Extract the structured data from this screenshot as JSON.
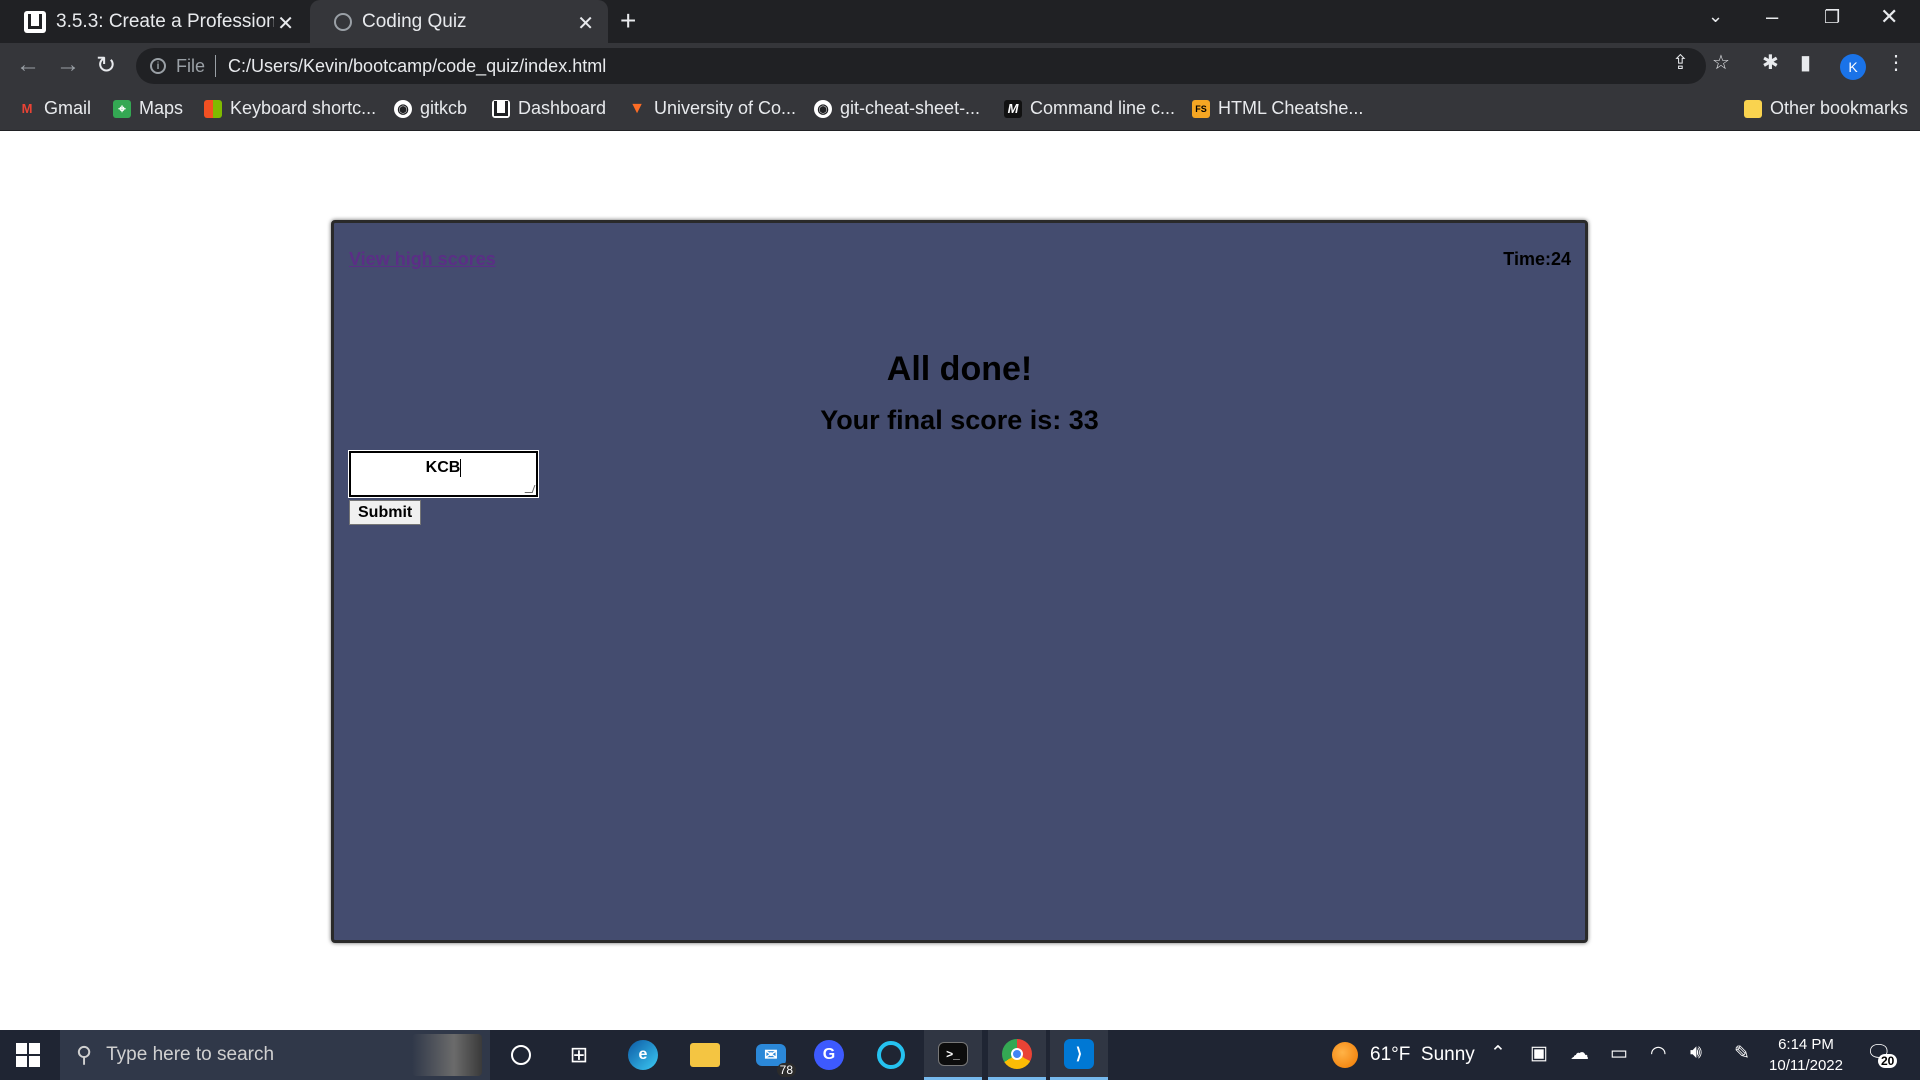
{
  "browser": {
    "tabs": [
      {
        "title": "3.5.3: Create a Professional P",
        "icon": "u-icon",
        "active": false
      },
      {
        "title": "Coding Quiz",
        "icon": "globe-icon",
        "active": true
      }
    ],
    "new_tab_label": "+",
    "address": {
      "scheme": "File",
      "url": "C:/Users/Kevin/bootcamp/code_quiz/index.html"
    },
    "profile_initial": "K",
    "bookmarks": [
      {
        "label": "Gmail",
        "icon": "gmail-icon",
        "color": "#ea4335"
      },
      {
        "label": "Maps",
        "icon": "maps-icon",
        "color": "#34a853"
      },
      {
        "label": "Keyboard shortc...",
        "icon": "windows-icon",
        "color": "#f25022"
      },
      {
        "label": "gitkcb",
        "icon": "github-icon",
        "color": "#ffffff"
      },
      {
        "label": "Dashboard",
        "icon": "u-icon",
        "color": "#ffffff"
      },
      {
        "label": "University of Co...",
        "icon": "gitlab-icon",
        "color": "#fc6d26"
      },
      {
        "label": "git-cheat-sheet-...",
        "icon": "github-icon",
        "color": "#ffffff"
      },
      {
        "label": "Command line c...",
        "icon": "m-icon",
        "color": "#ffffff"
      },
      {
        "label": "HTML Cheatshe...",
        "icon": "fs-icon",
        "color": "#f5a623"
      }
    ],
    "other_bookmarks": "Other bookmarks"
  },
  "quiz": {
    "high_scores_link": "View high scores",
    "timer": "Time:24",
    "heading": "All done!",
    "final_score": "Your final score is: 33",
    "initials_value": "KCB",
    "submit_label": "Submit",
    "card_color": "#444c6f",
    "link_color": "#5b2e86"
  },
  "taskbar": {
    "search_placeholder": "Type here to search",
    "mail_badge": "78",
    "weather": "61°F  Sunny",
    "time": "6:14 PM",
    "date": "10/11/2022",
    "notification_count": "20"
  }
}
